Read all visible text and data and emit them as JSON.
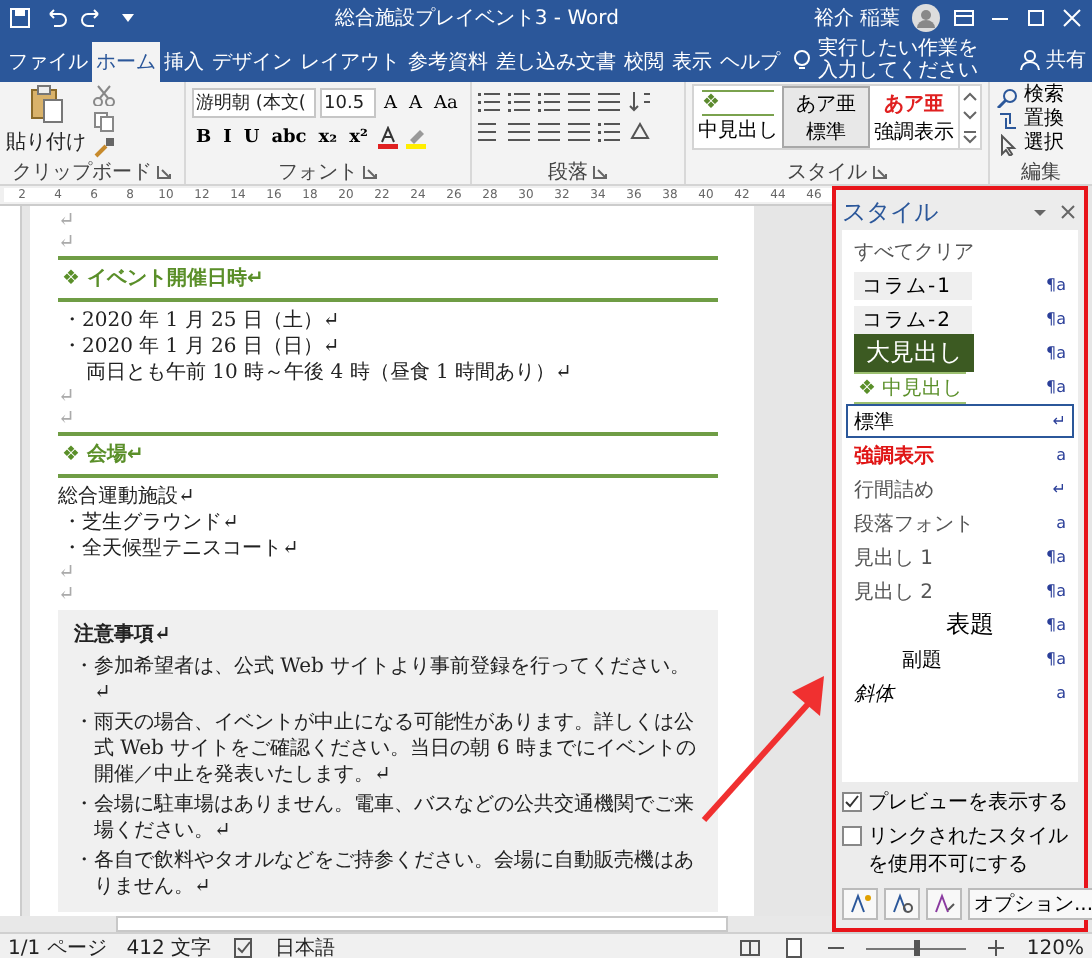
{
  "title_bar": {
    "title": "総合施設プレイベント3 - Word",
    "user": "裕介 稲葉"
  },
  "tabs": [
    {
      "label": "ファイル",
      "selected": false
    },
    {
      "label": "ホーム",
      "selected": true
    },
    {
      "label": "挿入",
      "selected": false
    },
    {
      "label": "デザイン",
      "selected": false
    },
    {
      "label": "レイアウト",
      "selected": false
    },
    {
      "label": "参考資料",
      "selected": false
    },
    {
      "label": "差し込み文書",
      "selected": false
    },
    {
      "label": "校閲",
      "selected": false
    },
    {
      "label": "表示",
      "selected": false
    },
    {
      "label": "ヘルプ",
      "selected": false
    }
  ],
  "tell_me": "実行したい作業を入力してください",
  "share": "共有",
  "ribbon": {
    "clipboard": {
      "paste": "貼り付け",
      "label": "クリップボード"
    },
    "font": {
      "name": "游明朝 (本文(",
      "size": "10.5",
      "row1": [
        "A",
        "A",
        "Aa"
      ],
      "row2": [
        "B",
        "I",
        "U",
        "abc",
        "x₂",
        "x²"
      ],
      "label": "フォント"
    },
    "paragraph": {
      "label": "段落"
    },
    "styles": {
      "label": "スタイル",
      "items": [
        {
          "name": "中見出し",
          "sample": "❖",
          "kind": "mid-heading",
          "selected": false
        },
        {
          "name": "標準",
          "sample": "あア亜",
          "kind": "normal",
          "selected": true
        },
        {
          "name": "強調表示",
          "sample": "あア亜",
          "kind": "emphasis",
          "selected": false
        }
      ]
    },
    "editing": {
      "label": "編集",
      "items": [
        "検索",
        "置換",
        "選択"
      ]
    }
  },
  "ruler": {
    "numbers": [
      "2",
      "4",
      "6",
      "8",
      "10",
      "12",
      "14",
      "16",
      "18",
      "20",
      "22",
      "24",
      "26",
      "28",
      "30",
      "32",
      "34",
      "36",
      "38",
      "40",
      "42",
      "44",
      "46"
    ]
  },
  "document": {
    "blocks": [
      {
        "kind": "mark",
        "text": "↵"
      },
      {
        "kind": "mark",
        "text": "↵"
      },
      {
        "kind": "heading",
        "text": "❖ イベント開催日時↵"
      },
      {
        "kind": "bullet",
        "text": "・2020 年 1 月 25 日（土）↵"
      },
      {
        "kind": "bullet",
        "text": "・2020 年 1 月 26 日（日）↵"
      },
      {
        "kind": "indent",
        "text": "両日とも午前 10 時～午後 4 時（昼食 1 時間あり）↵"
      },
      {
        "kind": "mark",
        "text": "↵"
      },
      {
        "kind": "mark",
        "text": "↵"
      },
      {
        "kind": "heading",
        "text": "❖ 会場↵"
      },
      {
        "kind": "body",
        "text": "総合運動施設↵"
      },
      {
        "kind": "bullet",
        "text": "・芝生グラウンド↵"
      },
      {
        "kind": "bullet",
        "text": "・全天候型テニスコート↵"
      },
      {
        "kind": "mark",
        "text": "↵"
      },
      {
        "kind": "mark",
        "text": "↵"
      }
    ],
    "note": {
      "title": "注意事項↵",
      "items": [
        "・参加希望者は、公式 Web サイトより事前登録を行ってください。↵",
        "・雨天の場合、イベントが中止になる可能性があります。詳しくは公式 Web サイトをご確認ください。当日の朝 6 時までにイベントの開催／中止を発表いたします。↵",
        "・会場に駐車場はありません。電車、バスなどの公共交通機関でご来場ください。↵",
        "・各自で飲料やタオルなどをご持参ください。会場に自動販売機はありません。↵"
      ]
    }
  },
  "styles_pane": {
    "title": "スタイル",
    "items": [
      {
        "name": "すべてクリア",
        "kind": "clear",
        "selected": false
      },
      {
        "name": "コラム-1",
        "kind": "column",
        "mark": "¶a",
        "selected": false
      },
      {
        "name": "コラム-2",
        "kind": "column",
        "mark": "¶a",
        "selected": false
      },
      {
        "name": "大見出し",
        "kind": "big-heading",
        "mark": "¶a",
        "selected": false
      },
      {
        "name": "中見出し",
        "prefix": "❖",
        "kind": "mid-heading",
        "mark": "¶a",
        "selected": false
      },
      {
        "name": "標準",
        "kind": "normal",
        "mark": "↵",
        "selected": true
      },
      {
        "name": "強調表示",
        "kind": "emphasis",
        "mark": "a",
        "selected": false
      },
      {
        "name": "行間詰め",
        "kind": "plain",
        "mark": "↵",
        "selected": false
      },
      {
        "name": "段落フォント",
        "kind": "plain",
        "mark": "a",
        "selected": false
      },
      {
        "name": "見出し 1",
        "kind": "plain",
        "mark": "¶a",
        "selected": false
      },
      {
        "name": "見出し 2",
        "kind": "plain",
        "mark": "¶a",
        "selected": false
      },
      {
        "name": "表題",
        "kind": "title",
        "mark": "¶a",
        "selected": false
      },
      {
        "name": "副題",
        "kind": "subtitle",
        "mark": "¶a",
        "selected": false
      },
      {
        "name": "斜体",
        "kind": "italic",
        "mark": "a",
        "selected": false
      }
    ],
    "options": [
      {
        "label": "プレビューを表示する",
        "checked": true
      },
      {
        "label": "リンクされたスタイルを使用不可にする",
        "checked": false
      }
    ],
    "options_button": "オプション..."
  },
  "status_bar": {
    "page": "1/1 ページ",
    "words": "412 文字",
    "language": "日本語",
    "zoom": "120%",
    "zoom_slider": {
      "level": 0.5
    }
  }
}
